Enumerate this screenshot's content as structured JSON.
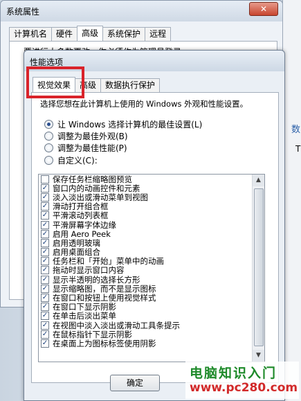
{
  "sys_window": {
    "title": "系统属性",
    "close_glyph": "✕",
    "tabs": [
      "计算机名",
      "硬件",
      "高级",
      "系统保护",
      "远程"
    ],
    "active_tab": 2,
    "panel_text": "要进行大多数更改，你必须作为管理员登录"
  },
  "right_fragment": {
    "frag1": "数",
    "frag2": "T",
    "frag3": ""
  },
  "dialog": {
    "title": "性能选项",
    "tabs": [
      "视觉效果",
      "高级",
      "数据执行保护"
    ],
    "active_tab": 0,
    "description": "选择您想在此计算机上使用的 Windows 外观和性能设置。",
    "radios": [
      {
        "label": "让 Windows 选择计算机的最佳设置(L)",
        "checked": true
      },
      {
        "label": "调整为最佳外观(B)",
        "checked": false
      },
      {
        "label": "调整为最佳性能(P)",
        "checked": false
      },
      {
        "label": "自定义(C):",
        "checked": false
      }
    ],
    "options": [
      {
        "label": "保存任务栏缩略图预览",
        "checked": false
      },
      {
        "label": "窗口内的动画控件和元素",
        "checked": true
      },
      {
        "label": "淡入淡出或滑动菜单到视图",
        "checked": true
      },
      {
        "label": "滑动打开组合框",
        "checked": true
      },
      {
        "label": "平滑滚动列表框",
        "checked": true
      },
      {
        "label": "平滑屏幕字体边缘",
        "checked": true
      },
      {
        "label": "启用 Aero Peek",
        "checked": true
      },
      {
        "label": "启用透明玻璃",
        "checked": true
      },
      {
        "label": "启用桌面组合",
        "checked": true
      },
      {
        "label": "任务栏和「开始」菜单中的动画",
        "checked": true
      },
      {
        "label": "拖动时显示窗口内容",
        "checked": true
      },
      {
        "label": "显示半透明的选择长方形",
        "checked": true
      },
      {
        "label": "显示缩略图，而不是显示图标",
        "checked": true
      },
      {
        "label": "在窗口和按钮上使用视觉样式",
        "checked": true
      },
      {
        "label": "在窗口下显示阴影",
        "checked": true
      },
      {
        "label": "在单击后淡出菜单",
        "checked": true
      },
      {
        "label": "在视图中淡入淡出或滑动工具条提示",
        "checked": true
      },
      {
        "label": "在鼠标指针下显示阴影",
        "checked": true
      },
      {
        "label": "在桌面上为图标标签使用阴影",
        "checked": true
      }
    ],
    "ok_label": "确定"
  },
  "watermark": {
    "line1": "电脑知识入门",
    "line2": "www.pc280.com"
  },
  "colors": {
    "highlight": "#d9232a",
    "watermark_green": "#1e8a2a",
    "watermark_red": "#d22a2a"
  }
}
